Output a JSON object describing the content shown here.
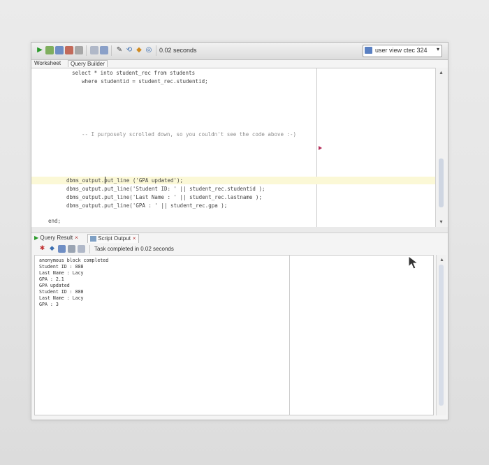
{
  "toolbar": {
    "timing": "0.02 seconds",
    "connection_label": "user view ctec 324",
    "icons": [
      "run-statement-icon",
      "run-script-icon",
      "commit-icon",
      "rollback-icon",
      "autotrace-icon",
      "explain-plan-icon",
      "sql-tuning-icon",
      "clear-icon",
      "history-icon",
      "format-icon"
    ]
  },
  "editor_tabs": {
    "worksheet": "Worksheet",
    "query_builder": "Query Builder"
  },
  "editor": {
    "lines": [
      {
        "text": "select * into student_rec from students",
        "style": "code"
      },
      {
        "text": "where studentid = student_rec.studentid;",
        "style": "code"
      },
      {
        "text": "-- I purposely scrolled down, so you couldn't see the code above :-)",
        "style": "comment"
      },
      {
        "text": "dbms_output.put_line ('GPA updated');",
        "style": "current"
      },
      {
        "text": "dbms_output.put_line('Student ID: ' || student_rec.studentid );",
        "style": "code"
      },
      {
        "text": "dbms_output.put_line('Last Name : ' || student_rec.lastname );",
        "style": "code"
      },
      {
        "text": "dbms_output.put_line('GPA : ' || student_rec.gpa );",
        "style": "code"
      },
      {
        "text": "end;",
        "style": "code"
      }
    ]
  },
  "output_tabs": {
    "query_result": "Query Result",
    "script_output": "Script Output"
  },
  "output_toolbar": {
    "message": "Task completed in 0.02 seconds"
  },
  "output": {
    "lines": [
      "anonymous block completed",
      "Student ID : 888",
      "Last Name : Lacy",
      "GPA : 2.1",
      "GPA updated",
      "Student ID : 888",
      "Last Name : Lacy",
      "GPA : 3"
    ]
  }
}
